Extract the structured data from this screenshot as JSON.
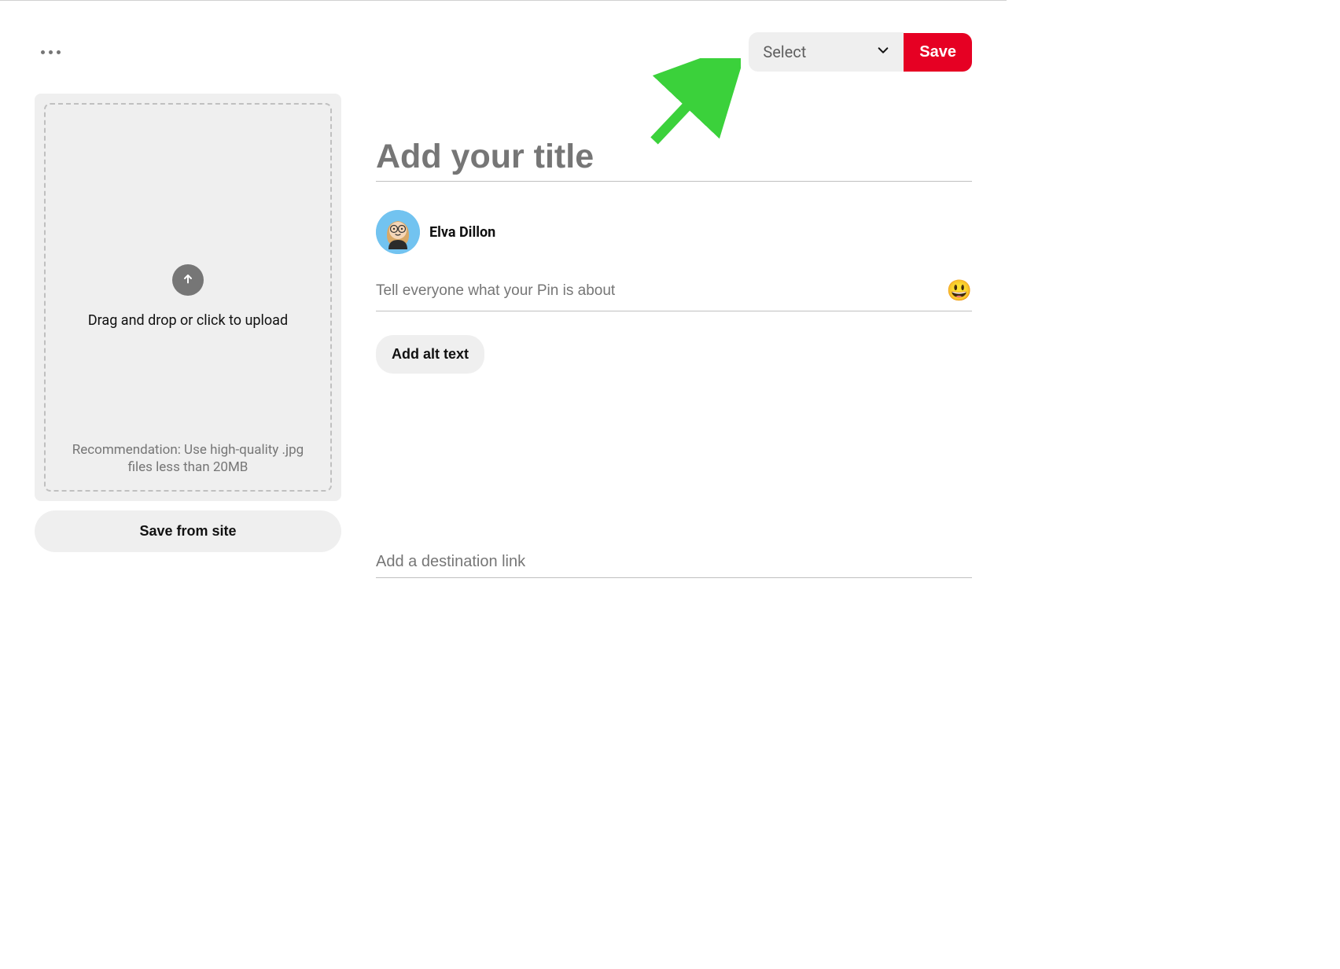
{
  "toolbar": {
    "board_select_label": "Select",
    "save_label": "Save"
  },
  "upload": {
    "drag_text": "Drag and drop or click to upload",
    "recommendation": "Recommendation: Use high-quality .jpg files less than 20MB",
    "save_from_site_label": "Save from site"
  },
  "form": {
    "title_placeholder": "Add your title",
    "description_placeholder": "Tell everyone what your Pin is about",
    "alt_text_label": "Add alt text",
    "link_placeholder": "Add a destination link"
  },
  "user": {
    "name": "Elva Dillon"
  },
  "icons": {
    "emoji": "😃"
  }
}
